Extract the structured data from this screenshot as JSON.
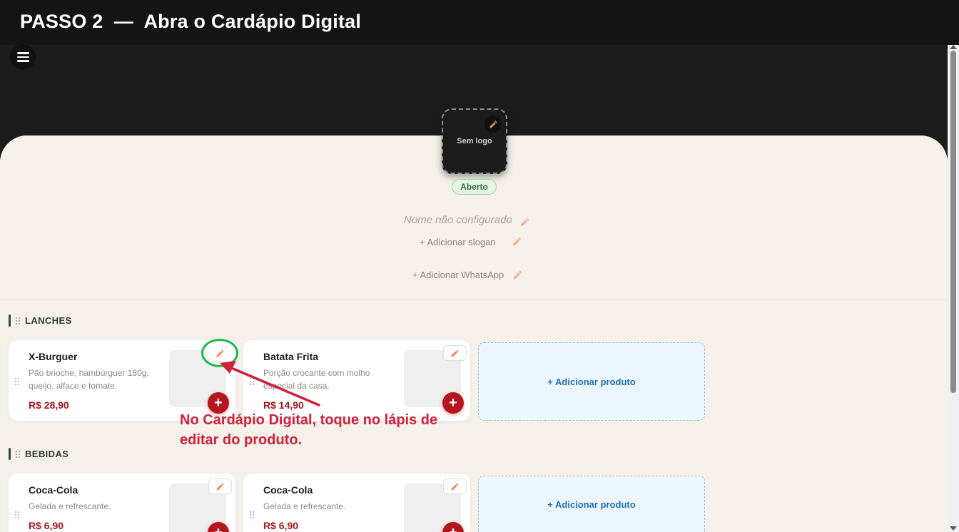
{
  "banner": {
    "title": "PASSO 2  —  Abra o Cardápio Digital"
  },
  "header": {
    "menu_icon": "hamburger-menu-icon"
  },
  "store": {
    "logo_label": "Sem logo",
    "status": "Aberto",
    "name_placeholder": "Nome não configurado",
    "slogan_prompt": "+ Adicionar slogan",
    "whatsapp_prompt": "+ Adicionar WhatsApp"
  },
  "sections": [
    {
      "title": "LANCHES",
      "products": [
        {
          "name": "X-Burguer",
          "description": "Pão brioche, hambúrguer 180g, queijo, alface e tomate.",
          "price": "R$ 28,90"
        },
        {
          "name": "Batata Frita",
          "description": "Porção crocante com molho especial da casa.",
          "price": "R$ 14,90"
        }
      ],
      "add_label": "+ Adicionar produto"
    },
    {
      "title": "BEBIDAS",
      "products": [
        {
          "name": "Coca-Cola",
          "description": "Gelada e refrescante.",
          "price": "R$ 6,90"
        },
        {
          "name": "Coca-Cola",
          "description": "Gelada e refrescante.",
          "price": "R$ 6,90"
        }
      ],
      "add_label": "+ Adicionar produto"
    }
  ],
  "annotation": {
    "text": "No Cardápio Digital, toque no lápis de editar do produto."
  },
  "colors": {
    "accent_red": "#b3161c",
    "price_red": "#a8161b",
    "annotation_red": "#d0203a",
    "annotation_green": "#1fb84c",
    "pencil_orange": "#e8875f",
    "link_blue": "#1f6fb8"
  }
}
